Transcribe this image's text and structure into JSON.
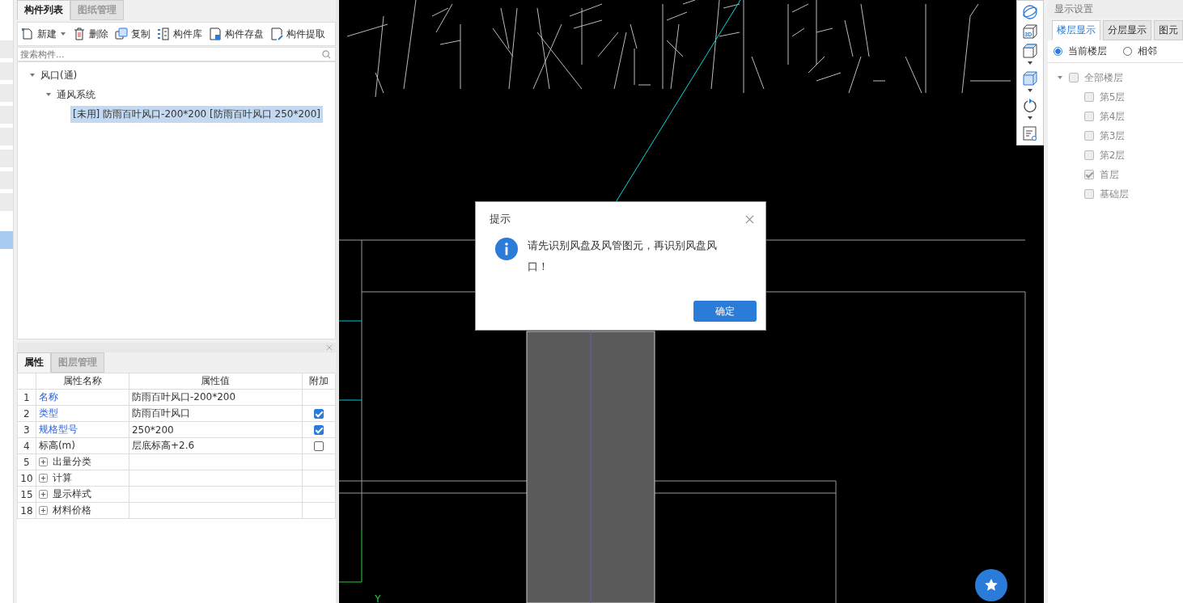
{
  "sidebar": {
    "items": [
      {
        "selected": false
      },
      {
        "selected": false
      },
      {
        "selected": false
      },
      {
        "selected": false
      },
      {
        "selected": false
      },
      {
        "selected": false
      },
      {
        "selected": false
      },
      {
        "selected": false
      },
      {
        "selected": true
      }
    ]
  },
  "component_panel": {
    "tabs": [
      {
        "label": "构件列表",
        "selected": true
      },
      {
        "label": "图纸管理",
        "selected": false
      }
    ],
    "toolbar": [
      {
        "label": "新建",
        "kind": "new",
        "has_menu": true
      },
      {
        "label": "删除",
        "kind": "delete",
        "has_menu": false
      },
      {
        "label": "复制",
        "kind": "copy",
        "has_menu": false
      },
      {
        "label": "构件库",
        "kind": "library",
        "has_menu": false
      },
      {
        "label": "构件存盘",
        "kind": "save",
        "has_menu": false
      },
      {
        "label": "构件提取",
        "kind": "extract",
        "has_menu": false
      }
    ],
    "search": {
      "placeholder": "搜索构件..."
    },
    "tree": [
      {
        "label": "风口(通)",
        "expanded": true,
        "selected": false,
        "children": [
          {
            "label": "通风系统",
            "expanded": true,
            "selected": false,
            "children": [
              {
                "label": "[未用] 防雨百叶风口-200*200 [防雨百叶风口 250*200]",
                "selected": true
              }
            ]
          }
        ]
      }
    ]
  },
  "properties_panel": {
    "tabs": [
      {
        "label": "属性",
        "selected": true
      },
      {
        "label": "图层管理",
        "selected": false
      }
    ],
    "columns": [
      "属性名称",
      "属性值",
      "附加"
    ],
    "rows": [
      {
        "index": "1",
        "name": "名称",
        "value": "防雨百叶风口-200*200",
        "kind": "plain",
        "public": true
      },
      {
        "index": "2",
        "name": "类型",
        "value": "防雨百叶风口",
        "kind": "attr",
        "public": true,
        "attached": true
      },
      {
        "index": "3",
        "name": "规格型号",
        "value": "250*200",
        "kind": "attr",
        "public": true,
        "attached": true
      },
      {
        "index": "4",
        "name": "标高(m)",
        "value": "层底标高+2.6",
        "kind": "attr",
        "public": false,
        "attached": false
      },
      {
        "index": "5",
        "name": "出量分类",
        "kind": "group",
        "public": false
      },
      {
        "index": "10",
        "name": "计算",
        "kind": "group",
        "public": false
      },
      {
        "index": "15",
        "name": "显示样式",
        "kind": "group",
        "public": false
      },
      {
        "index": "18",
        "name": "材料价格",
        "kind": "group",
        "public": false
      }
    ]
  },
  "view_toolbar": [
    {
      "kind": "orbit",
      "has_menu": false
    },
    {
      "kind": "view3d",
      "label": "3D",
      "has_menu": false
    },
    {
      "kind": "cube",
      "has_menu": true
    },
    {
      "kind": "cube-filled",
      "has_menu": true
    },
    {
      "kind": "rotate",
      "has_menu": true
    },
    {
      "kind": "layer-list",
      "has_menu": false
    }
  ],
  "canvas": {
    "axis_label": "Y"
  },
  "dialog": {
    "title": "提示",
    "message": "请先识别风盘及风管图元，再识别风盘风口！",
    "button": "确定"
  },
  "display_panel": {
    "title": "显示设置",
    "tabs": [
      {
        "label": "楼层显示",
        "selected": true
      },
      {
        "label": "分层显示",
        "selected": false
      },
      {
        "label": "图元",
        "selected": false
      }
    ],
    "radios": [
      {
        "label": "当前楼层",
        "selected": true
      },
      {
        "label": "相邻",
        "selected": false
      }
    ],
    "floors": {
      "label": "全部楼层",
      "checked": false,
      "expanded": true,
      "children": [
        {
          "label": "第5层",
          "checked": false
        },
        {
          "label": "第4层",
          "checked": false
        },
        {
          "label": "第3层",
          "checked": false
        },
        {
          "label": "第2层",
          "checked": false
        },
        {
          "label": "首层",
          "checked": true
        },
        {
          "label": "基础层",
          "checked": false
        }
      ]
    }
  }
}
